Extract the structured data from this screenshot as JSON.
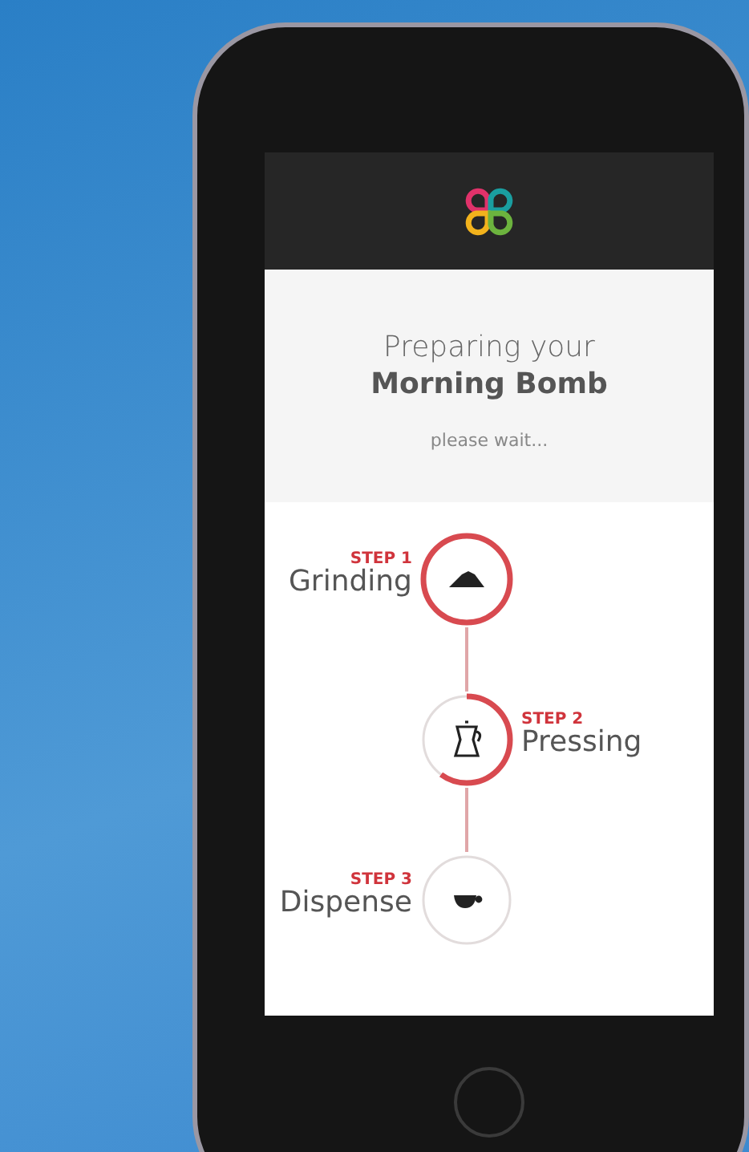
{
  "header": {
    "title_line_1": "Preparing your",
    "title_line_2": "Morning Bomb",
    "subtitle": "please wait..."
  },
  "steps": [
    {
      "label": "STEP 1",
      "name": "Grinding",
      "kind": "grounds",
      "level": 1
    },
    {
      "label": "STEP 2",
      "name": "Pressing",
      "kind": "pot",
      "level": 0.6
    },
    {
      "label": "STEP 3",
      "name": "Dispense",
      "kind": "cup",
      "level": 0
    }
  ]
}
